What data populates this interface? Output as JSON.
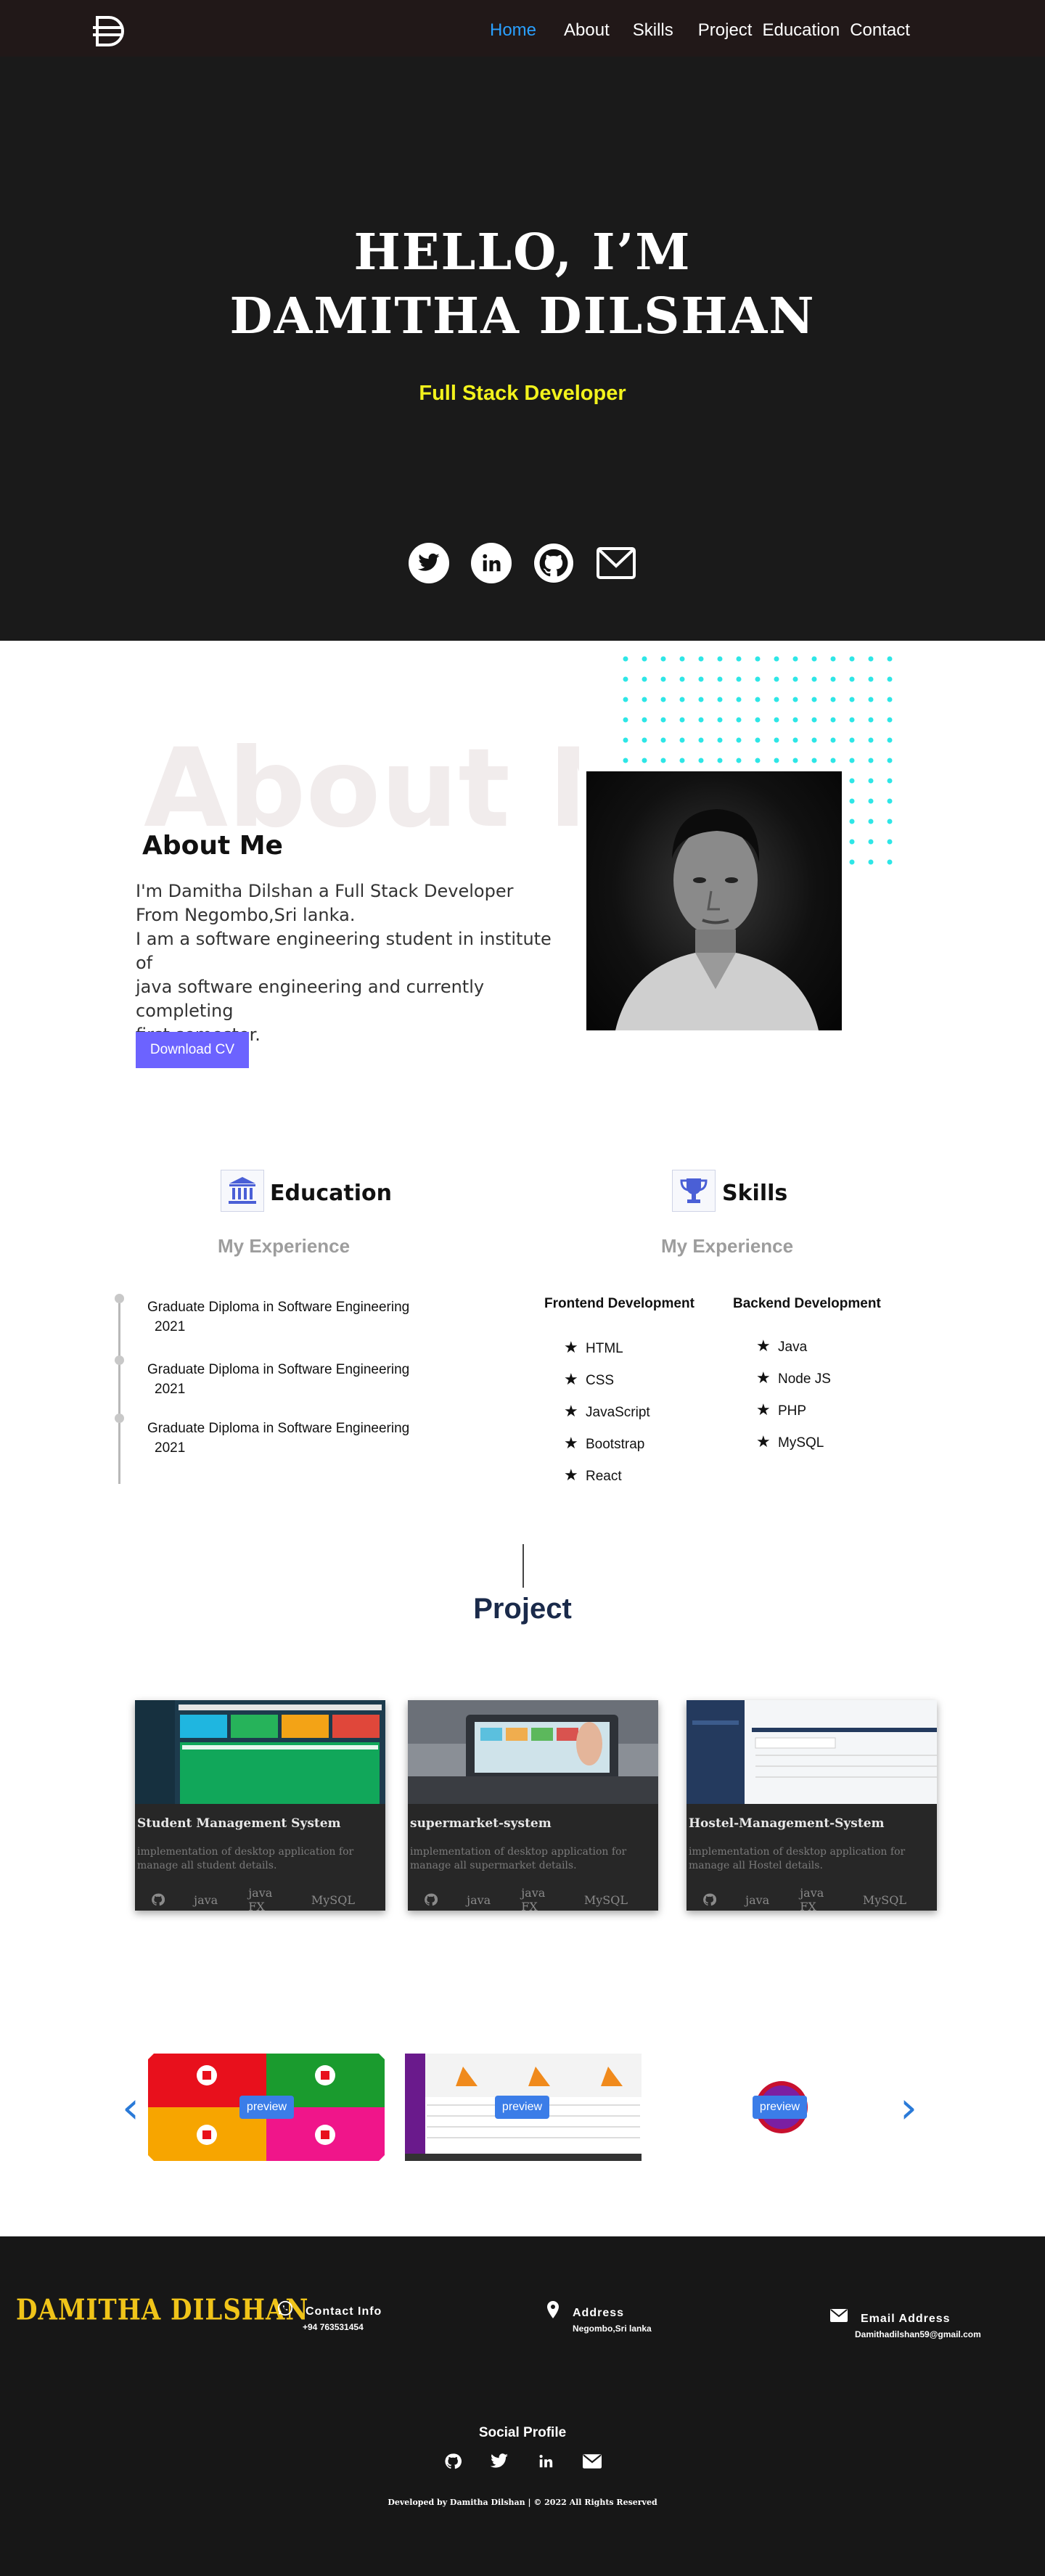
{
  "nav": {
    "items": [
      {
        "label": "Home",
        "active": true
      },
      {
        "label": "About"
      },
      {
        "label": "Skills"
      },
      {
        "label": "Project"
      },
      {
        "label": "Education"
      },
      {
        "label": "Contact"
      }
    ]
  },
  "hero": {
    "line1": "HELLO, I’M",
    "line2": "DAMITHA DILSHAN",
    "role": "Full Stack Developer",
    "role_color": "#f2f21c",
    "socials": [
      "twitter-icon",
      "linkedin-icon",
      "github-icon",
      "mail-icon"
    ]
  },
  "about": {
    "bg_text": "About Me",
    "heading": "About Me",
    "lines": [
      "I'm Damitha Dilshan a Full Stack Developer",
      "From Negombo,Sri lanka.",
      "I am a software engineering student in institute of",
      "java  software engineering and currently completing",
      "first semester."
    ],
    "cv_button": "Download CV",
    "accent": "#6c63ff",
    "dots_color": "#2ee6e6"
  },
  "education": {
    "title": "Education",
    "subtitle": "My Experience",
    "items": [
      {
        "title": "Graduate Diploma in Software Engineering",
        "year": "2021"
      },
      {
        "title": "Graduate Diploma in Software Engineering",
        "year": "2021"
      },
      {
        "title": "Graduate Diploma in Software Engineering",
        "year": "2021"
      }
    ]
  },
  "skills": {
    "title": "Skills",
    "subtitle": "My Experience",
    "frontend_title": "Frontend Development",
    "frontend": [
      "HTML",
      "CSS",
      "JavaScript",
      "Bootstrap",
      "React"
    ],
    "backend_title": "Backend Development",
    "backend": [
      "Java",
      "Node JS",
      "PHP",
      "MySQL"
    ]
  },
  "projects": {
    "title": "Project",
    "cards": [
      {
        "title": "Student Management System",
        "desc": "implementation of desktop application for manage all student details.",
        "tags": [
          "java",
          "java FX",
          "MySQL"
        ]
      },
      {
        "title": "supermarket-system",
        "desc": "implementation of desktop application for manage all supermarket details.",
        "tags": [
          "java",
          "java FX",
          "MySQL"
        ]
      },
      {
        "title": "Hostel-Management-System",
        "desc": "implementation of desktop application for manage all Hostel details.",
        "tags": [
          "java",
          "java FX",
          "MySQL"
        ]
      }
    ],
    "preview_label": "preview",
    "prev_arrow": "‹",
    "next_arrow": "›"
  },
  "footer": {
    "brand": "DAMITHA DILSHAN",
    "contact_label": "Contact Info",
    "contact_value": "+94 763531454",
    "address_label": "Address",
    "address_value": "Negombo,Sri lanka",
    "email_label": "Email Address",
    "email_value": "Damithadilshan59@gmail.com",
    "social_title": "Social Profile",
    "copyright": "Developed by Damitha Dilshan | © 2022 All Rights Reserved",
    "brand_color": "#f0c419"
  }
}
